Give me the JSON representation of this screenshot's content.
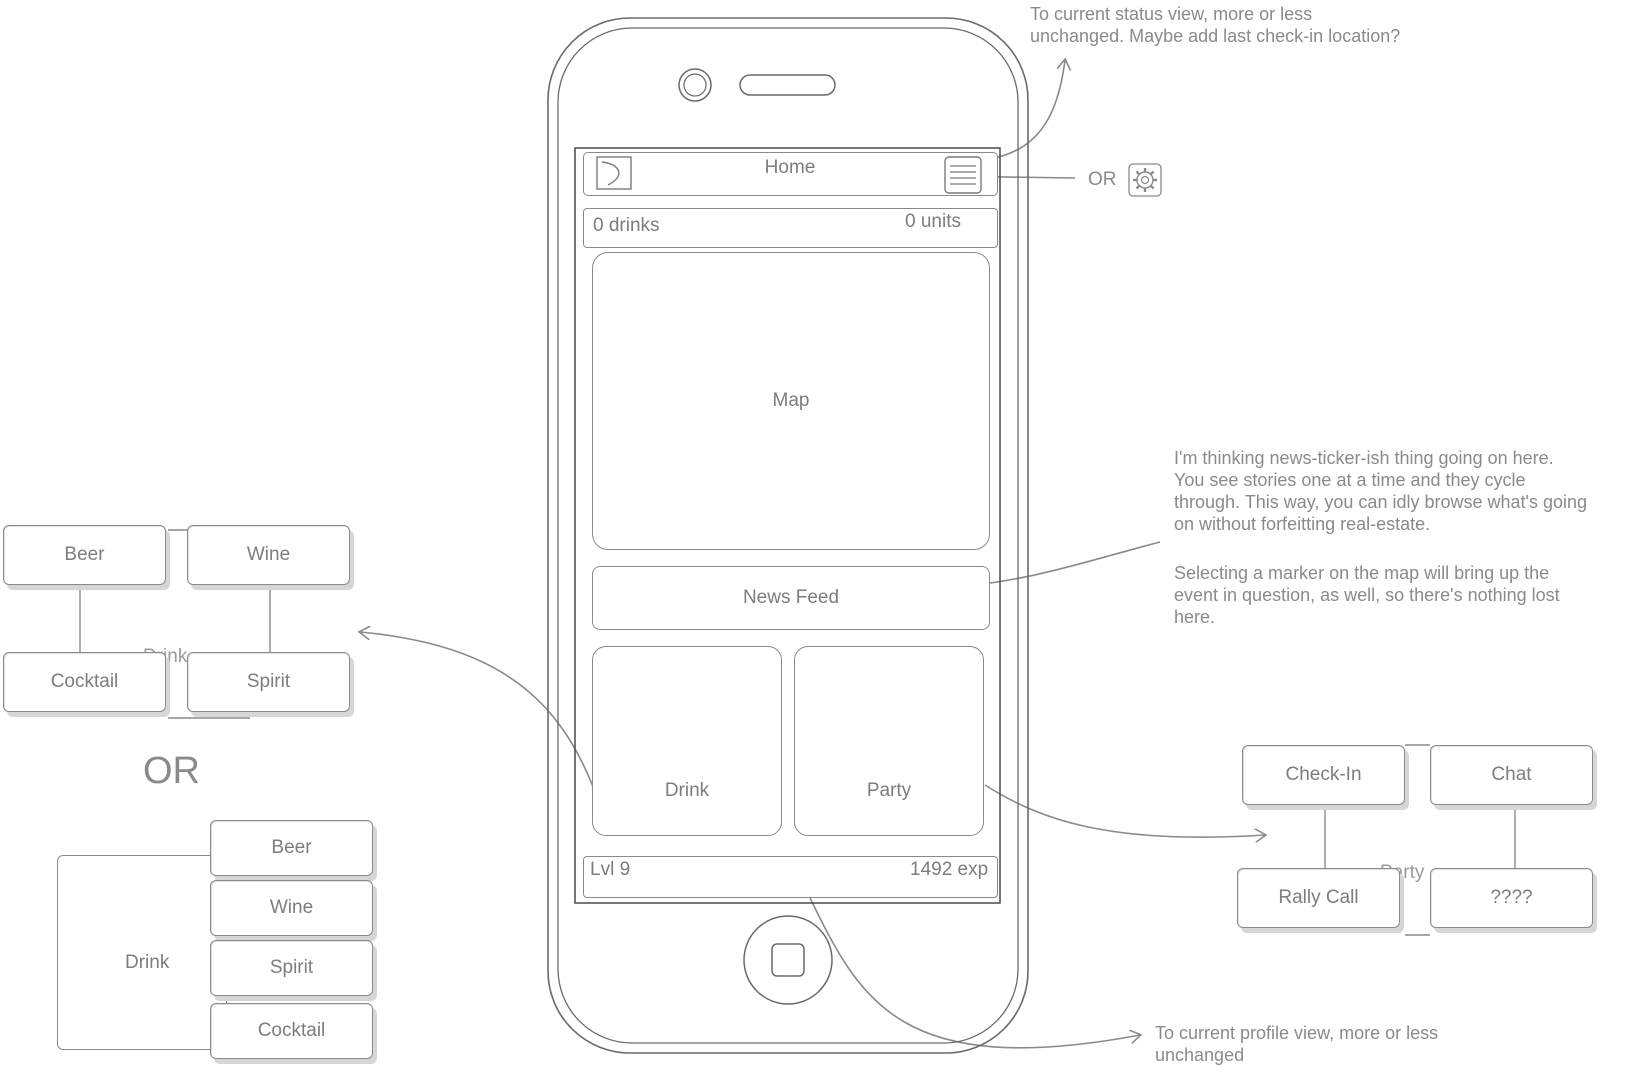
{
  "phone": {
    "header_title": "Home",
    "drinks_label": "0 drinks",
    "units_label": "0 units",
    "map_label": "Map",
    "news_feed_label": "News Feed",
    "drink_button": "Drink",
    "party_button": "Party",
    "level_label": "Lvl 9",
    "exp_label": "1492 exp"
  },
  "annotations": {
    "menu_note": "To current status view, more or less\nunchanged. Maybe add last check-in location?",
    "or_label": "OR",
    "news_note_1": "I'm thinking news-ticker-ish thing going on here.\nYou see stories one at a time and they cycle\nthrough. This way, you can idly browse what's going\non without forfeitting real-estate.",
    "news_note_2": "Selecting a marker on the map will bring up the\nevent in question, as well, so there's nothing lost\nhere.",
    "profile_note": "To current profile view, more or less\nunchanged"
  },
  "drink_grid": {
    "center_label": "Drink",
    "items": [
      "Beer",
      "Wine",
      "Cocktail",
      "Spirit"
    ]
  },
  "big_or": "OR",
  "drink_list": {
    "side_label": "Drink",
    "items": [
      "Beer",
      "Wine",
      "Spirit",
      "Cocktail"
    ]
  },
  "party_grid": {
    "center_label": "Party",
    "items": [
      "Check-In",
      "Chat",
      "Rally Call",
      "????"
    ]
  },
  "icons": [
    "back-icon",
    "menu-icon",
    "gear-icon",
    "camera-icon",
    "speaker-icon",
    "home-button-icon"
  ]
}
